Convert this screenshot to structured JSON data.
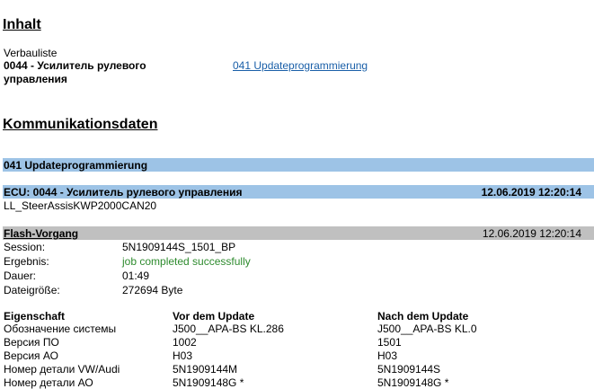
{
  "inhalt": {
    "title": "Inhalt",
    "list_label": "Verbauliste",
    "module_line1": "0044 - Усилитель рулевого",
    "module_line2": "управления",
    "link_text": "041 Updateprogrammierung"
  },
  "komm": {
    "title": "Kommunikationsdaten",
    "section_bar": "041 Updateprogrammierung",
    "ecu_label": "ECU: 0044 - Усилитель рулевого управления",
    "ecu_datetime": "12.06.2019 12:20:14",
    "ecu_id": "LL_SteerAssisKWP2000CAN20"
  },
  "flash": {
    "title": "Flash-Vorgang",
    "datetime": "12.06.2019 12:20:14",
    "rows": [
      {
        "label": "Session:",
        "value": "5N1909144S_1501_BP"
      },
      {
        "label": "Ergebnis:",
        "value": "job completed successfully"
      },
      {
        "label": "Dauer:",
        "value": "01:49"
      },
      {
        "label": "Dateigröße:",
        "value": "272694 Byte"
      }
    ]
  },
  "table": {
    "headers": [
      "Eigenschaft",
      "Vor dem Update",
      "Nach dem Update"
    ],
    "rows": [
      [
        "Обозначение системы",
        "J500__APA-BS KL.286",
        "J500__APA-BS KL.0"
      ],
      [
        "Версия ПО",
        "1002",
        "1501"
      ],
      [
        "Версия АО",
        "H03",
        "H03"
      ],
      [
        "Номер детали VW/Audi",
        "5N1909144M",
        "5N1909144S"
      ],
      [
        "Номер детали АО",
        "5N1909148G *",
        "5N1909148G *"
      ]
    ]
  },
  "colors": {
    "blue_bar": "#9dc3e6",
    "gray_bar": "#c0c0c0",
    "link": "#1a5fa8",
    "success": "#2e8b2e"
  }
}
